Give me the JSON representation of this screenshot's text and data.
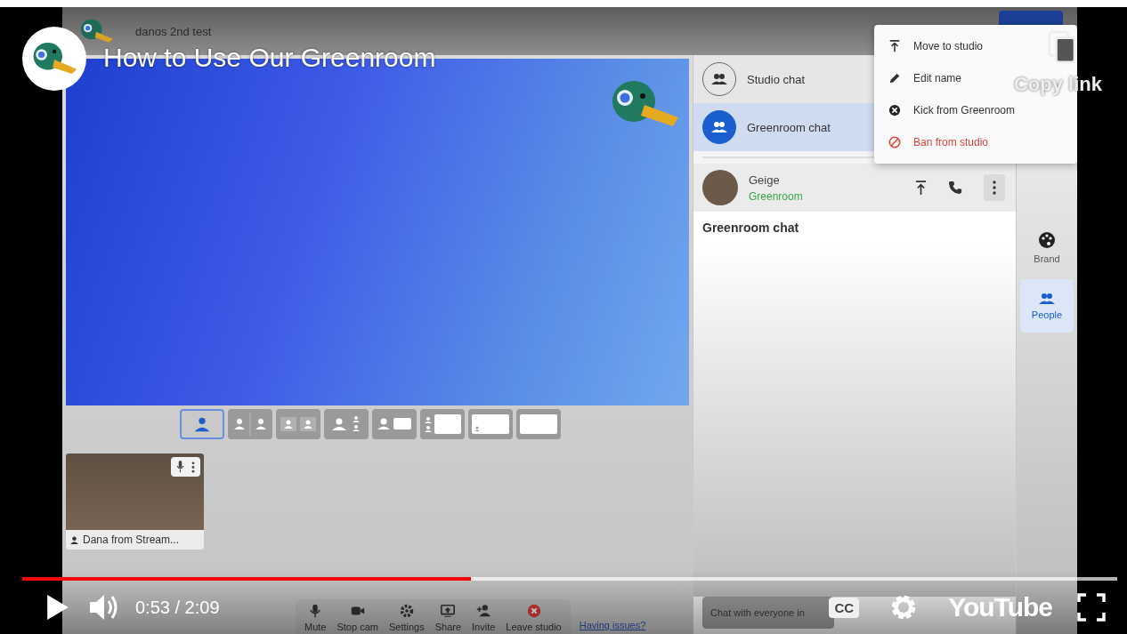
{
  "video": {
    "title": "How to Use Our Greenroom",
    "copy_link": "Copy link",
    "time": "0:53 / 2:09",
    "progress": {
      "level": 0.41
    },
    "captions_label": "CC",
    "logo_text": "YouTube"
  },
  "studio": {
    "name": "danos 2nd test",
    "layouts": [
      {
        "kind": "solo",
        "selected": true
      },
      {
        "kind": "split",
        "selected": false
      },
      {
        "kind": "split-small",
        "selected": false
      },
      {
        "kind": "group",
        "selected": false
      },
      {
        "kind": "person-screen",
        "selected": false
      },
      {
        "kind": "thin-screen",
        "selected": false
      },
      {
        "kind": "screen-pip",
        "selected": false
      },
      {
        "kind": "screen",
        "selected": false
      }
    ],
    "participant": {
      "name": "Dana from Stream..."
    },
    "toolbar": [
      {
        "kind": "mic",
        "label": "Mute"
      },
      {
        "kind": "cam",
        "label": "Stop cam"
      },
      {
        "kind": "gear",
        "label": "Settings"
      },
      {
        "kind": "share",
        "label": "Share"
      },
      {
        "kind": "invite",
        "label": "Invite"
      },
      {
        "kind": "leave",
        "label": "Leave studio"
      }
    ],
    "help_link": "Having issues?"
  },
  "chat_panel": {
    "tabs": [
      {
        "label": "Studio chat",
        "selected": false
      },
      {
        "label": "Greenroom chat",
        "selected": true
      }
    ],
    "guest": {
      "name": "Geige",
      "status": "Greenroom"
    },
    "heading": "Greenroom chat",
    "input": {
      "placeholder": "Chat with everyone in"
    }
  },
  "menu": [
    {
      "kind": "normal",
      "label": "Move to studio"
    },
    {
      "kind": "normal",
      "label": "Edit name"
    },
    {
      "kind": "normal",
      "label": "Kick from Greenroom"
    },
    {
      "kind": "danger",
      "label": "Ban from studio"
    }
  ],
  "side_tabs": [
    {
      "label": "Brand",
      "selected": false
    },
    {
      "label": "People",
      "selected": true
    }
  ]
}
